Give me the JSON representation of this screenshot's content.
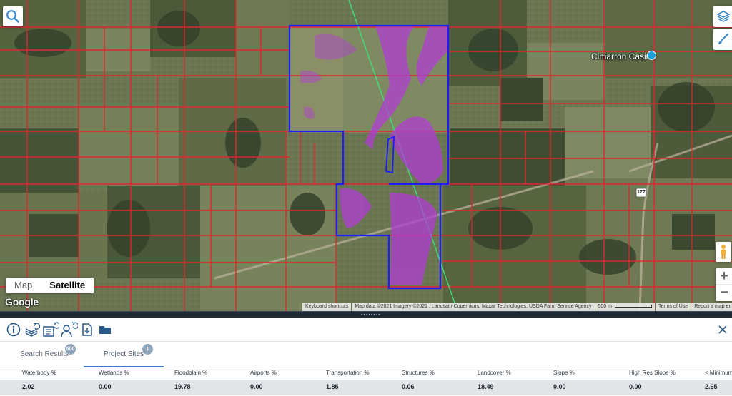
{
  "map": {
    "map_type_options": [
      "Map",
      "Satellite"
    ],
    "map_type_selected": "Satellite",
    "logo_text": "Google",
    "place_label": "Cimarron Casino",
    "highway_shield": "177",
    "attribution": {
      "shortcuts": "Keyboard shortcuts",
      "data": "Map data ©2021 Imagery ©2021 , Landsat / Copernicus, Maxar Technologies, USDA Farm Service Agency",
      "scale": "500 m",
      "terms": "Terms of Use",
      "report": "Report a map error"
    },
    "zoom_in": "+",
    "zoom_out": "−",
    "colors": {
      "parcel_lines": "#e0262d",
      "site_boundary": "#1c1cff",
      "floodplain": "#b23ad8",
      "transmission_line": "#3ee07a"
    }
  },
  "panel": {
    "toolbar_icons": [
      "info-icon",
      "layers-refresh-icon",
      "report-refresh-icon",
      "users-refresh-icon",
      "download-file-icon",
      "folder-icon"
    ],
    "close_label": "✕",
    "tabs": [
      {
        "label": "Search Results",
        "badge": "500"
      },
      {
        "label": "Project Sites",
        "badge": "1"
      }
    ],
    "active_tab": "Project Sites",
    "columns": [
      "Waterbody %",
      "Wetlands %",
      "Floodplain %",
      "Airports %",
      "Transportation %",
      "Structures %",
      "Landcover %",
      "Slope %",
      "High Res Slope %",
      "< Minimum"
    ],
    "rows": [
      [
        "2.02",
        "0.00",
        "19.78",
        "0.00",
        "1.85",
        "0.06",
        "18.49",
        "0.00",
        "0.00",
        "2.65"
      ]
    ],
    "accent_color": "#3d7ac6"
  }
}
